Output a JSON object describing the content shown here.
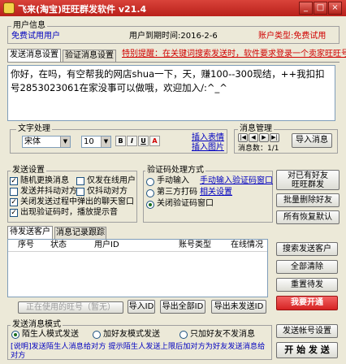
{
  "window": {
    "title": "飞来(淘宝)旺旺群发软件 v21.4",
    "min": "_",
    "max": "□",
    "close": "×"
  },
  "user_info": {
    "legend": "用户信息",
    "user": "免费试用用户",
    "expiry": "用户到期时间:2016-2-6",
    "account_type": "账户类型:免费试用"
  },
  "tabs": {
    "send_msg": "发送消息设置",
    "verify_msg": "验证消息设置"
  },
  "notice": "特别提醒：在关键词搜索发送时，软件要求登录一个卖家旺旺号",
  "message": "你好，在吗，有空帮我的网店shua一下，天，赚100--300现结，++我扣扣号2853023061在家没事可以做哦，欢迎加入/:^_^",
  "text_proc": {
    "legend": "文字处理",
    "font": "宋体",
    "size": "10",
    "insert_emoji": "插入表情",
    "insert_image": "插入图片",
    "icon_b": "B",
    "icon_i": "I",
    "icon_u": "U",
    "icon_c": "A"
  },
  "msg_mgmt": {
    "legend": "消息管理",
    "page": "消息数：1/1",
    "import": "导入消息"
  },
  "send_settings": {
    "legend": "发送设置",
    "random_emoji": "随机更换消息",
    "only_online": "仅发在线用户",
    "send_shake": "发送并抖动对方",
    "only_shake": "仅抖动对方",
    "close_popup": "关闭发送过程中弹出的聊天窗口",
    "show_captcha": "出现验证码时，播放提示音"
  },
  "captcha": {
    "legend": "验证码处理方式",
    "manual": "手动输入",
    "manual_link": "手动输入验证码窗口",
    "third_party": "第三方打码",
    "third_party_link": "相关设置",
    "close_window": "关闭验证码窗口"
  },
  "right_buttons": {
    "group_friends": "对已有好友\n旺旺群发",
    "batch_delete": "批量删除好友",
    "restore_all": "所有恢复默认"
  },
  "list": {
    "tab_pending": "待发送客户",
    "tab_records": "消息记录跟踪",
    "col_seq": "序号",
    "col_status": "状态",
    "col_userid": "用户ID",
    "col_account": "账号类型",
    "col_send": "在线情况"
  },
  "list_buttons": {
    "search": "搜索发送客户",
    "clear": "全部清除",
    "resend": "重置待发",
    "upgrade": "我要开通"
  },
  "bottom_bar": {
    "current_id": "正在使用的旺号（暂无）",
    "import_id": "导入ID",
    "export_all": "导出全部ID",
    "export_unsent": "导出未发送ID"
  },
  "send_mode": {
    "legend": "发送消息模式",
    "stranger": "陌生人模式发送",
    "friend_add": "加好友模式发送",
    "friend_only": "只加好友不发消息",
    "note": "[说明]发送陌生人消息给对方 提示陌生人发送上限后加对方为好友发送消息给对方",
    "account_settings": "发送帐号设置",
    "start": "开 始 发 送"
  },
  "colors": {
    "title_bar": "#c4291f",
    "link_blue": "#0000c0",
    "alert_red": "#d00000"
  }
}
